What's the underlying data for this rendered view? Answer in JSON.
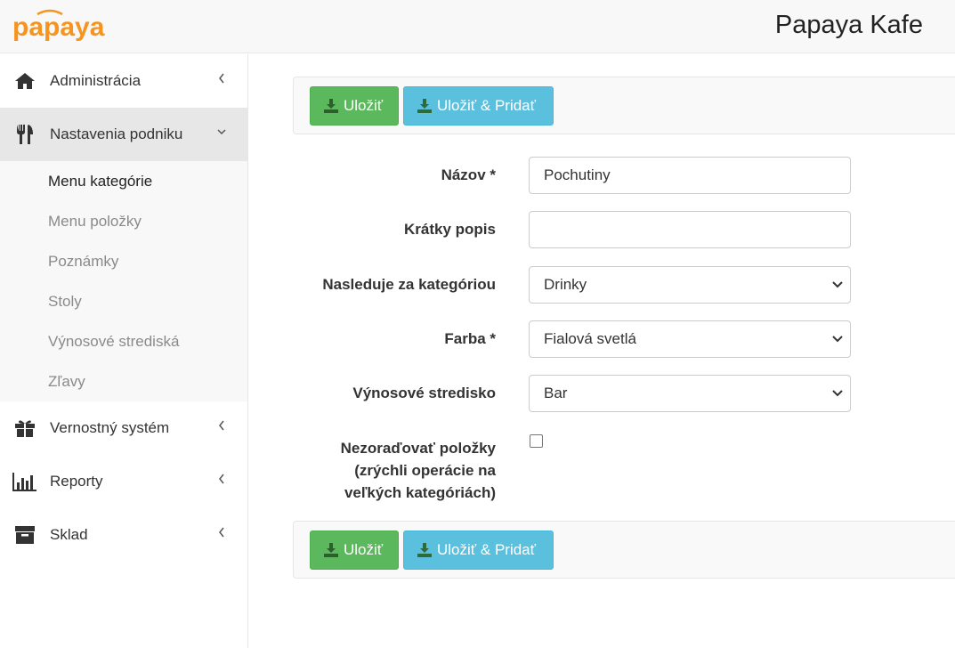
{
  "header": {
    "logo_text": "papaya",
    "title": "Papaya Kafe"
  },
  "sidebar": {
    "items": [
      {
        "label": "Administrácia",
        "icon": "home-icon"
      },
      {
        "label": "Nastavenia podniku",
        "icon": "utensils-icon"
      },
      {
        "label": "Vernostný systém",
        "icon": "gift-icon"
      },
      {
        "label": "Reporty",
        "icon": "bar-chart-icon"
      },
      {
        "label": "Sklad",
        "icon": "archive-icon"
      }
    ],
    "submenu": [
      "Menu kategórie",
      "Menu položky",
      "Poznámky",
      "Stoly",
      "Výnosové strediská",
      "Zľavy"
    ]
  },
  "toolbar": {
    "save_label": "Uložiť",
    "save_add_label": "Uložiť & Pridať"
  },
  "form": {
    "name_label": "Názov *",
    "name_value": "Pochutiny",
    "short_desc_label": "Krátky popis",
    "short_desc_value": "",
    "follows_label": "Nasleduje za kategóriou",
    "follows_value": "Drinky",
    "color_label": "Farba *",
    "color_value": "Fialová svetlá",
    "revenue_label": "Výnosové stredisko",
    "revenue_value": "Bar",
    "no_sort_label_1": "Nezoraďovať položky",
    "no_sort_label_2": "(zrýchli operácie na",
    "no_sort_label_3": "veľkých kategóriách)"
  },
  "colors": {
    "brand_orange": "#f7941d",
    "success": "#5cb85c",
    "info": "#5bc0de"
  }
}
